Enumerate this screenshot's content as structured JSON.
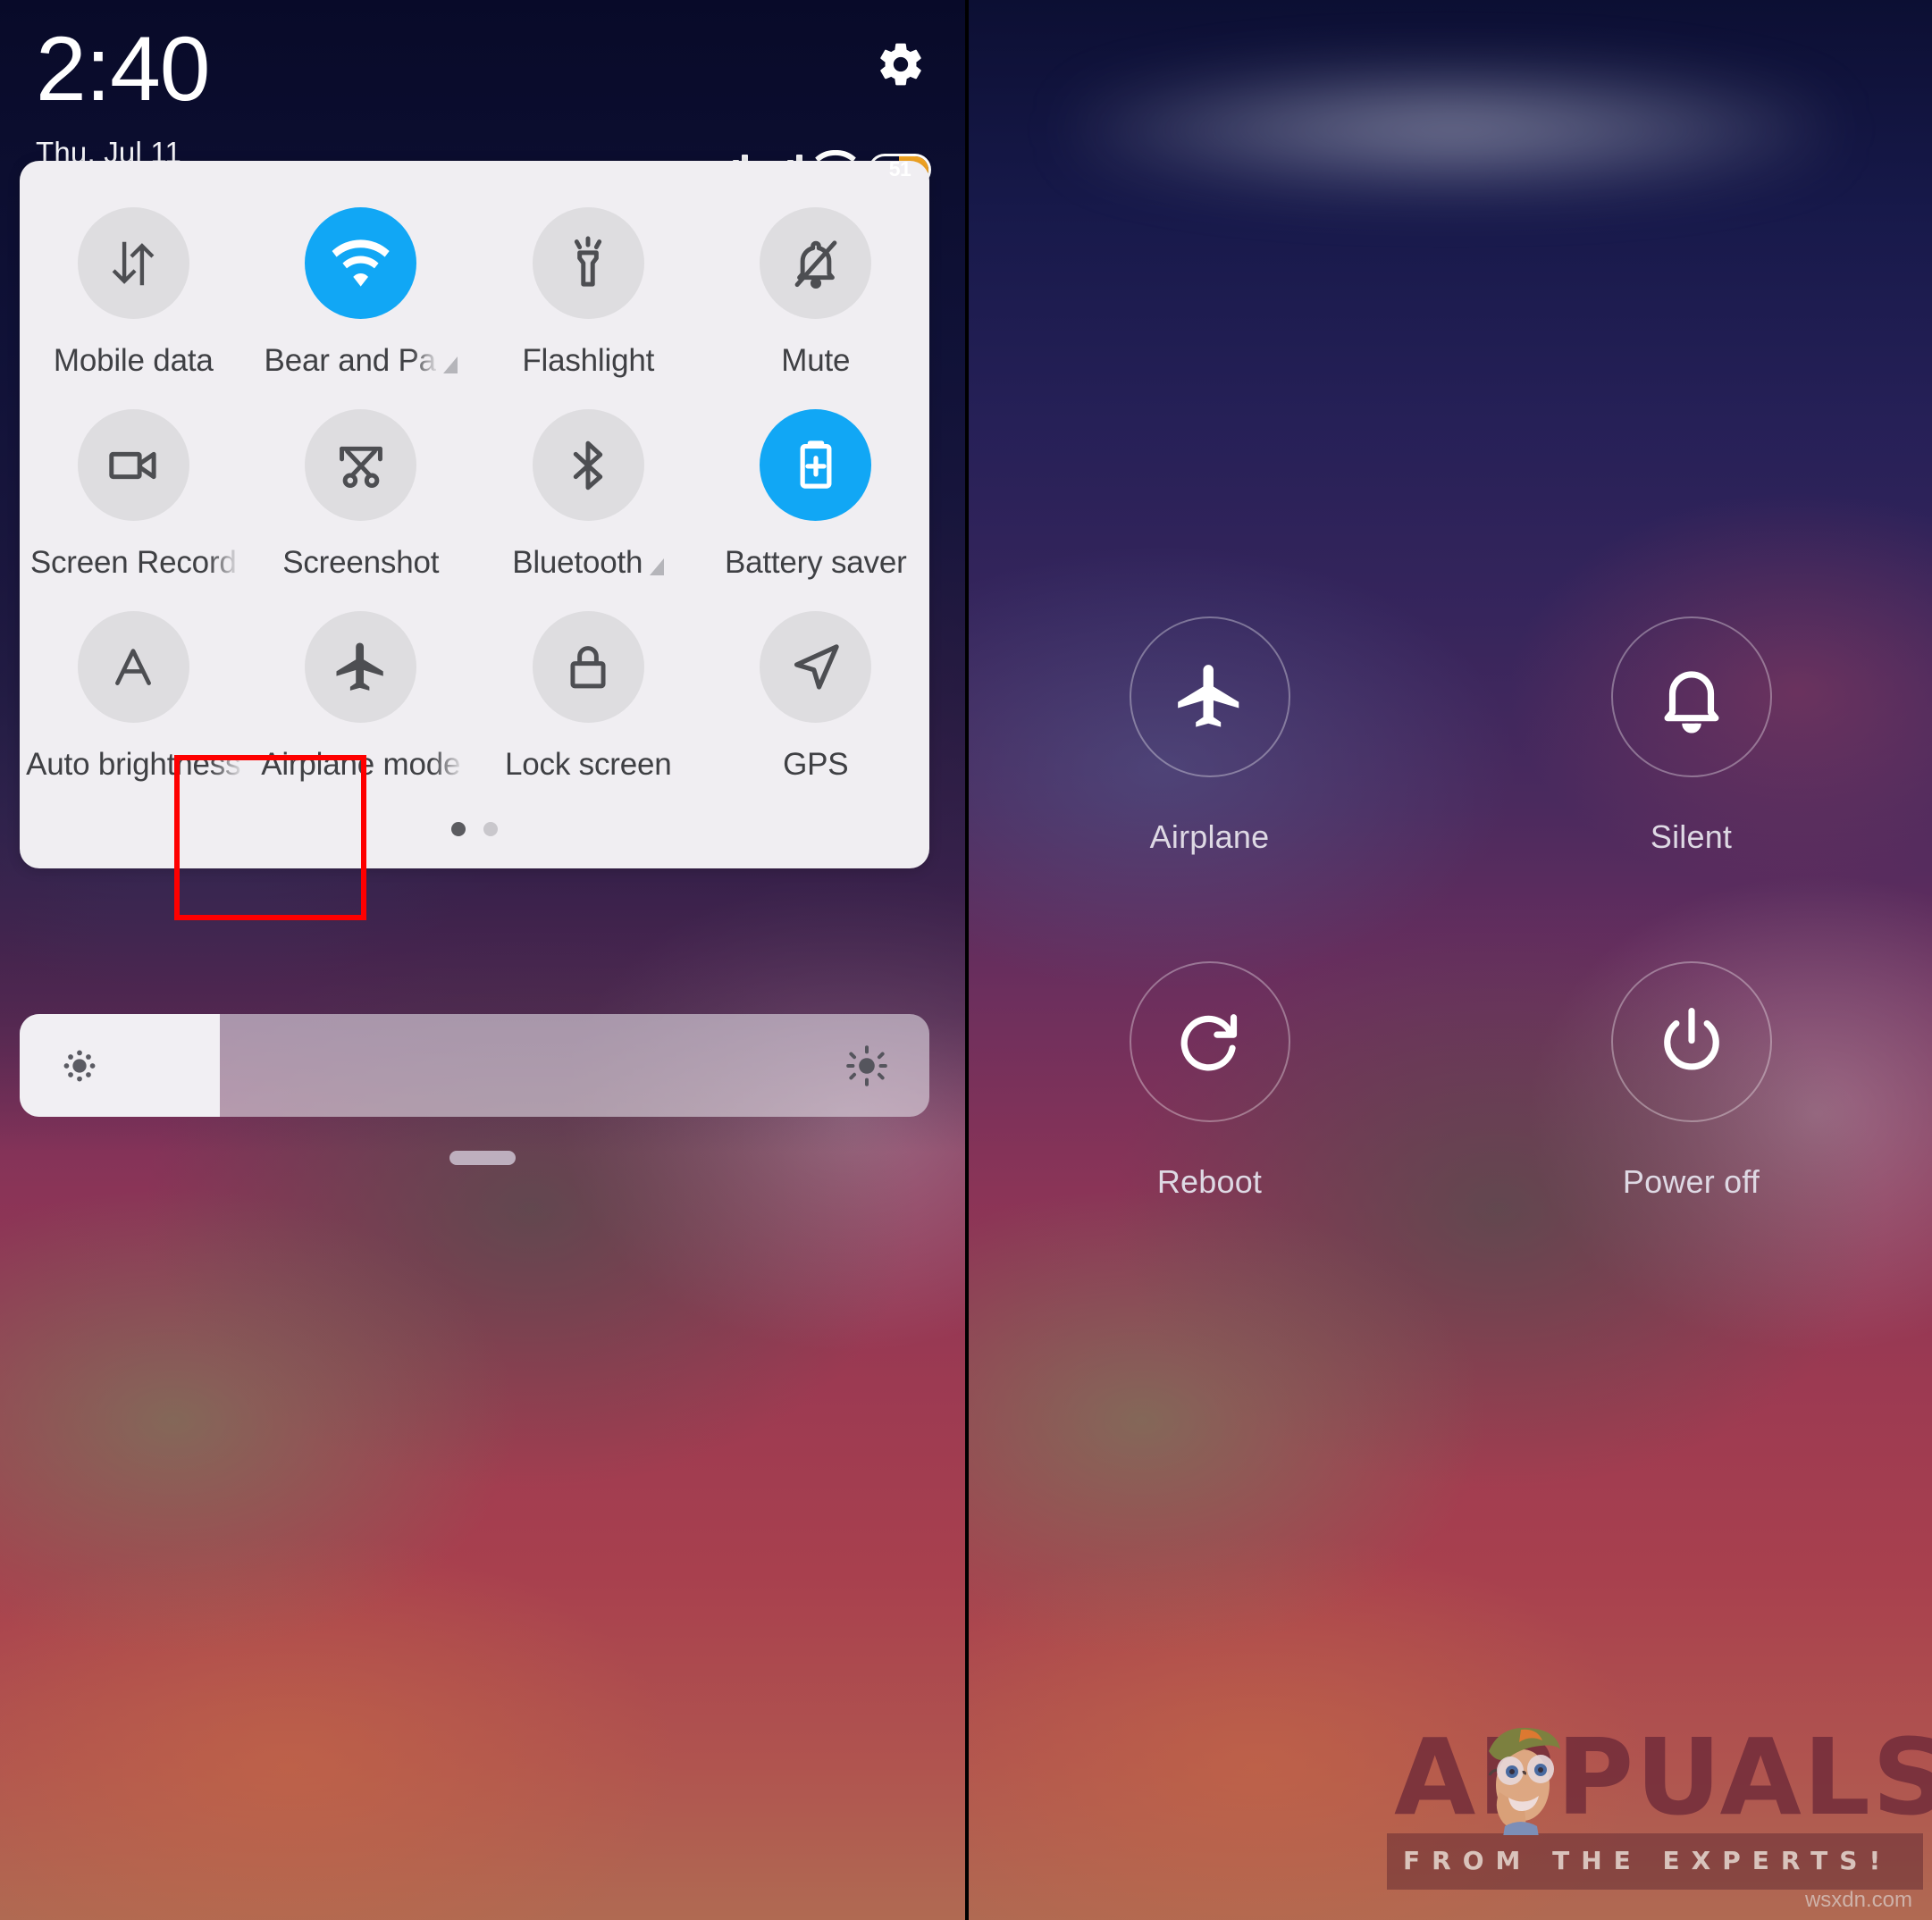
{
  "status_bar": {
    "time": "2:40",
    "date": "Thu, Jul 11",
    "gear_icon": "gear-icon",
    "signal_1_icon": "signal-bars-icon",
    "signal_2_icon": "signal-bars-icon",
    "wifi_icon": "wifi-icon",
    "battery_percent": "51",
    "battery_fill_color": "#f5a623"
  },
  "quick_settings": {
    "accent_color": "#11a7f5",
    "card_bg": "#f0eef2",
    "tile_bg": "#dedde0",
    "tiles": [
      {
        "label": "Mobile data",
        "icon": "mobile-data-icon",
        "active": false,
        "has_arrow": false,
        "clipped": false
      },
      {
        "label": "Bear and Pa",
        "icon": "wifi-icon",
        "active": true,
        "has_arrow": true,
        "clipped": true
      },
      {
        "label": "Flashlight",
        "icon": "flashlight-icon",
        "active": false,
        "has_arrow": false,
        "clipped": false
      },
      {
        "label": "Mute",
        "icon": "bell-muted-icon",
        "active": false,
        "has_arrow": false,
        "clipped": false
      },
      {
        "label": "Screen Record",
        "icon": "video-camera-icon",
        "active": false,
        "has_arrow": false,
        "clipped": true
      },
      {
        "label": "Screenshot",
        "icon": "scissors-icon",
        "active": false,
        "has_arrow": false,
        "clipped": false
      },
      {
        "label": "Bluetooth",
        "icon": "bluetooth-icon",
        "active": false,
        "has_arrow": true,
        "clipped": false
      },
      {
        "label": "Battery saver",
        "icon": "battery-plus-icon",
        "active": true,
        "has_arrow": false,
        "clipped": false
      },
      {
        "label": "Auto brightness",
        "icon": "auto-brightness-icon",
        "active": false,
        "has_arrow": false,
        "clipped": true
      },
      {
        "label": "Airplane mode",
        "icon": "airplane-icon",
        "active": false,
        "has_arrow": false,
        "clipped": true
      },
      {
        "label": "Lock screen",
        "icon": "lock-icon",
        "active": false,
        "has_arrow": false,
        "clipped": false
      },
      {
        "label": "GPS",
        "icon": "navigation-arrow-icon",
        "active": false,
        "has_arrow": false,
        "clipped": false
      }
    ],
    "page_dots": {
      "count": 2,
      "active_index": 0
    }
  },
  "brightness_slider": {
    "icon_low": "brightness-low-icon",
    "icon_high": "brightness-high-icon",
    "value_percent": "22"
  },
  "power_menu": {
    "items": [
      {
        "label": "Airplane",
        "icon": "airplane-icon"
      },
      {
        "label": "Silent",
        "icon": "bell-icon"
      },
      {
        "label": "Reboot",
        "icon": "reboot-icon"
      },
      {
        "label": "Power off",
        "icon": "power-icon"
      }
    ]
  },
  "highlights": {
    "color": "#fe0000",
    "boxes": [
      {
        "name": "airplane-mode-tile-highlight"
      },
      {
        "name": "airplane-power-option-highlight"
      }
    ]
  },
  "watermark": {
    "brand": "APPUALS",
    "tagline": "FROM THE EXPERTS!",
    "source": "wsxdn.com"
  }
}
